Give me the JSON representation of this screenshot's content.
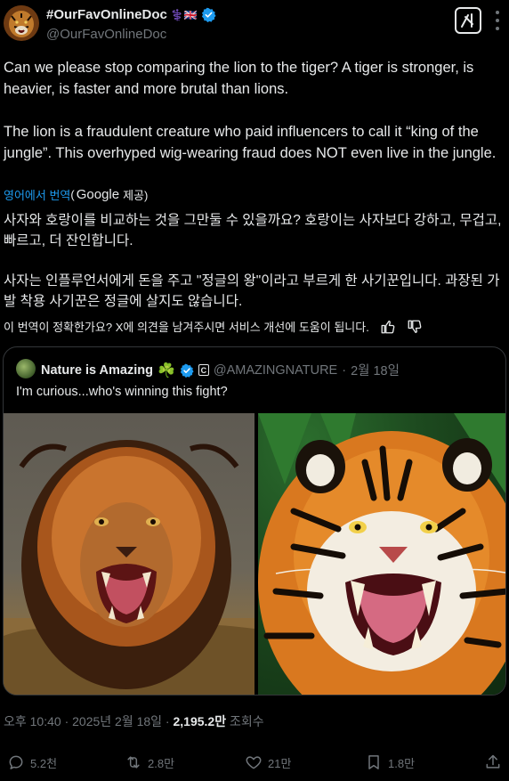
{
  "author": {
    "display_name": "#OurFavOnlineDoc",
    "name_suffix": "⚕️🇬🇧",
    "handle": "@OurFavOnlineDoc"
  },
  "tweet": {
    "paragraphs": [
      "Can we please stop comparing the lion to the tiger? A tiger is stronger, is heavier, is faster and more brutal than lions.",
      "The lion is a fraudulent creature who paid influencers to call it “king of the jungle”. This overhyped wig-wearing fraud does NOT even live in the jungle."
    ]
  },
  "translation": {
    "link_label": "영어에서 번역",
    "open_paren": "(",
    "google_word": "Google",
    "provider_tail": "제공)",
    "paragraphs": [
      "사자와 호랑이를 비교하는 것을 그만둘 수 있을까요? 호랑이는 사자보다 강하고, 무겁고, 빠르고, 더 잔인합니다.",
      "사자는 인플루언서에게 돈을 주고 \"정글의 왕\"이라고 부르게 한 사기꾼입니다. 과장된 가발 착용 사기꾼은 정글에 살지도 않습니다."
    ],
    "feedback_prompt": "이 번역이 정확한가요? X에 의견을 남겨주시면 서비스 개선에 도움이 됩니다."
  },
  "quote": {
    "display_name": "Nature is Amazing",
    "emoji": "☘️",
    "badge_letter": "C",
    "handle": "@AMAZINGNATURE",
    "dot": "·",
    "date": "2월 18일",
    "text": "I'm curious...who's winning this fight?"
  },
  "meta": {
    "time": "오후 10:40 · 2025년 2월 18일 · ",
    "views_count": "2,195.2만",
    "views_label": " 조회수"
  },
  "actions": {
    "replies": "5.2천",
    "reposts": "2.8만",
    "likes": "21만",
    "bookmarks": "1.8만"
  },
  "colors": {
    "background": "#000000",
    "text": "#e7e9ea",
    "secondary": "#71767b",
    "link": "#1d9bf0",
    "verified": "#1d9bf0",
    "border": "#333639"
  }
}
